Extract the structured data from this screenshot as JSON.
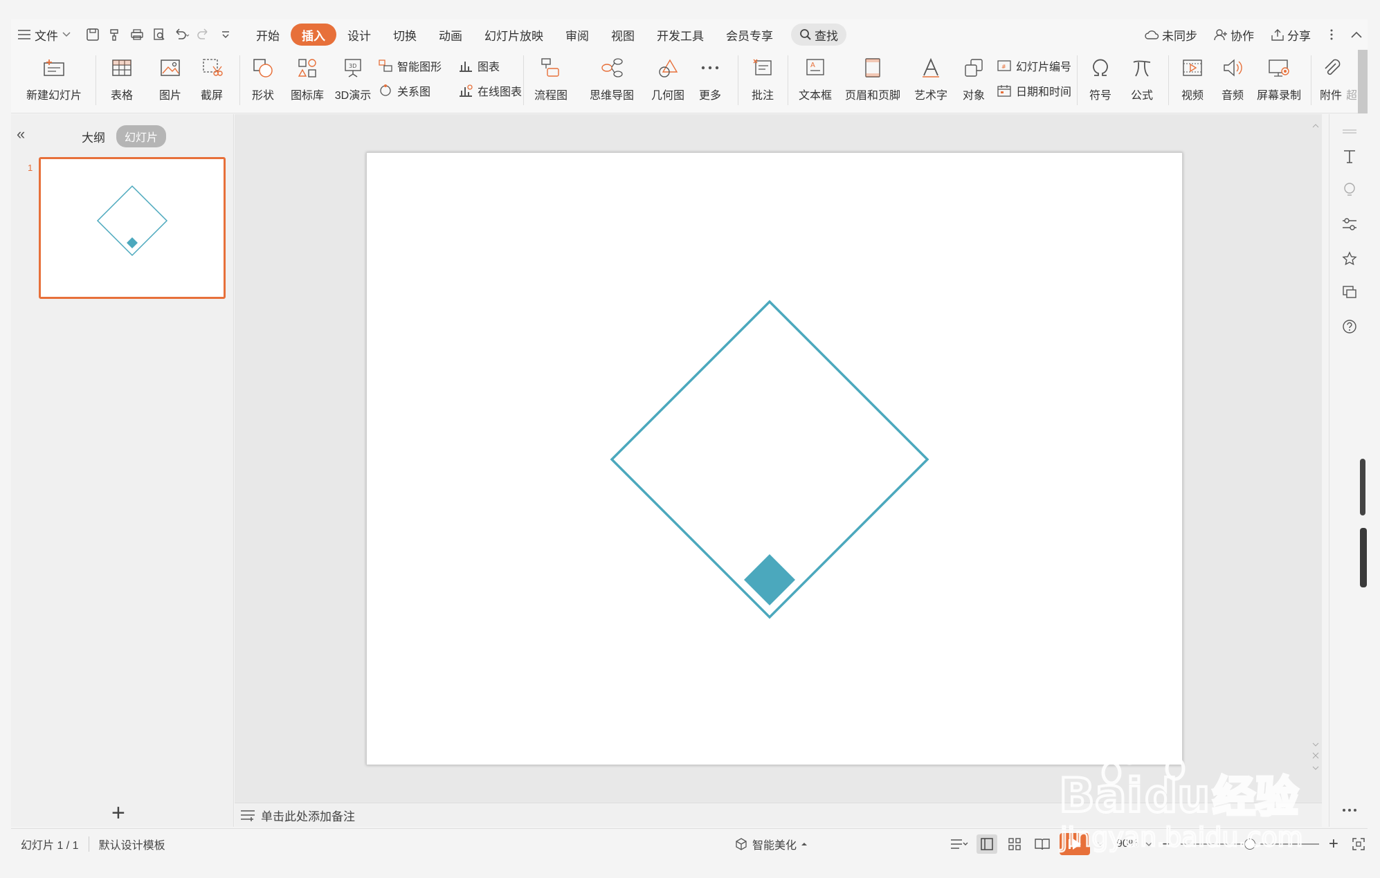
{
  "menubar": {
    "file_label": "文件",
    "tabs": [
      "开始",
      "插入",
      "设计",
      "切换",
      "动画",
      "幻灯片放映",
      "审阅",
      "视图",
      "开发工具",
      "会员专享"
    ],
    "active_tab_index": 1,
    "search_label": "查找",
    "sync_label": "未同步",
    "collab_label": "协作",
    "share_label": "分享"
  },
  "ribbon": {
    "new_slide": "新建幻灯片",
    "table": "表格",
    "picture": "图片",
    "screenshot": "截屏",
    "shape": "形状",
    "icon_lib": "图标库",
    "demo3d": "3D演示",
    "smart_art": "智能图形",
    "relation": "关系图",
    "chart": "图表",
    "online_chart": "在线图表",
    "flowchart": "流程图",
    "mindmap": "思维导图",
    "geometry": "几何图",
    "more": "更多",
    "comment": "批注",
    "textbox": "文本框",
    "header_footer": "页眉和页脚",
    "wordart": "艺术字",
    "object": "对象",
    "slide_number": "幻灯片编号",
    "date_time": "日期和时间",
    "symbol": "符号",
    "formula": "公式",
    "video": "视频",
    "audio": "音频",
    "screen_record": "屏幕录制",
    "attachment": "附件",
    "hyperlink_cut": "超"
  },
  "leftpane": {
    "outline_tab": "大纲",
    "slides_tab": "幻灯片",
    "slide_number": "1"
  },
  "notes": {
    "placeholder": "单击此处添加备注"
  },
  "statusbar": {
    "slide_info": "幻灯片 1 / 1",
    "template": "默认设计模板",
    "beautify": "智能美化",
    "zoom": "90%"
  },
  "colors": {
    "accent": "#e7703a",
    "shape": "#4ba8bd"
  },
  "watermark": {
    "text1": "Bai",
    "text2": "经验",
    "text3": "jingyan.baidu.com"
  }
}
